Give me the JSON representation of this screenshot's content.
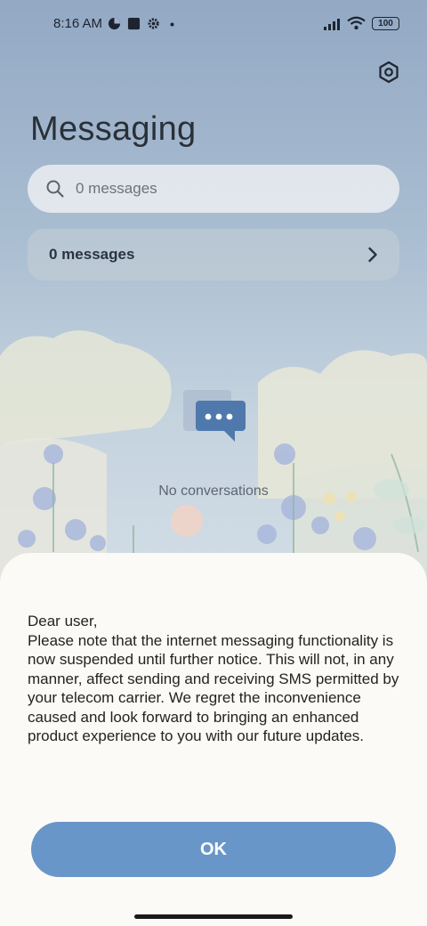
{
  "status_bar": {
    "time": "8:16 AM",
    "battery": "100",
    "icons": [
      "data-saver-icon",
      "square-notification-icon",
      "gear-small-icon",
      "dot-icon",
      "signal-icon",
      "wifi-icon",
      "battery-icon"
    ]
  },
  "header": {
    "title": "Messaging",
    "settings_icon": "settings-hexagon-icon"
  },
  "search": {
    "placeholder": "0 messages",
    "icon": "search-icon"
  },
  "message_count_row": {
    "label": "0 messages",
    "icon": "chevron-right-icon"
  },
  "empty_state": {
    "icon": "chat-bubble-icon",
    "text": "No conversations"
  },
  "dialog": {
    "lines": [
      "Dear user,",
      "Please note that the internet messaging functionality is now suspended until further notice. This will not, in any manner, affect sending and receiving SMS permitted by your telecom carrier. We regret the inconvenience caused and look forward to bringing an enhanced product experience to you with our future updates."
    ],
    "ok_label": "OK"
  },
  "colors": {
    "accent": "#6996c8",
    "chat_icon": "#4f79ad",
    "dialog_bg": "#fbfaf6"
  }
}
